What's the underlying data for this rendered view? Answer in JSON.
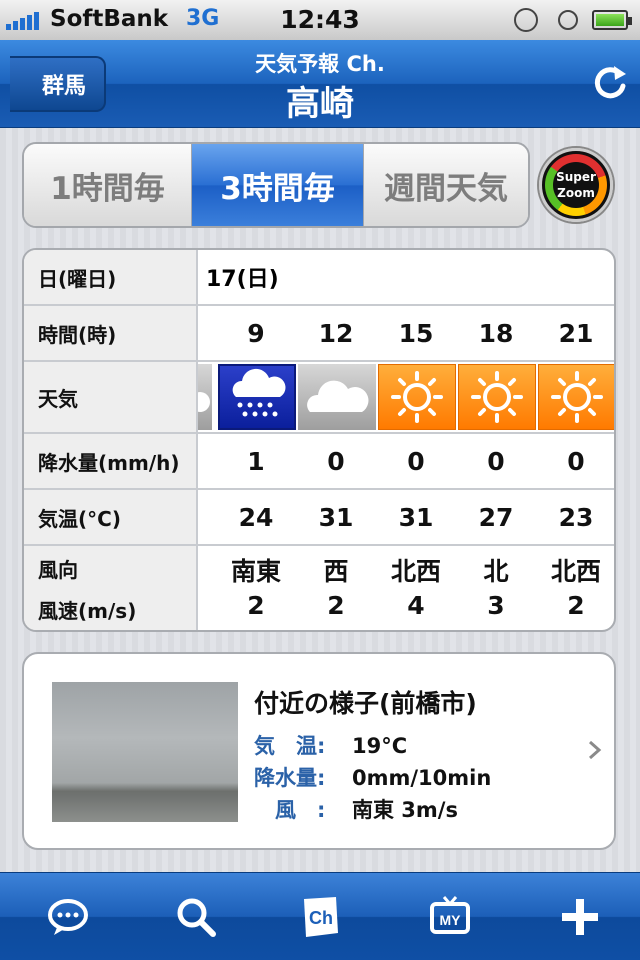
{
  "status_bar": {
    "carrier": "SoftBank",
    "network": "3G",
    "time": "12:43"
  },
  "nav": {
    "back_label": "群馬",
    "subtitle": "天気予報 Ch.",
    "title": "高崎",
    "refresh_icon": "refresh-icon"
  },
  "segments": {
    "items": [
      "1時間毎",
      "3時間毎",
      "週間天気"
    ],
    "selected": "3時間毎"
  },
  "super_zoom": {
    "line1": "Super",
    "line2": "Zoom"
  },
  "forecast": {
    "headers": {
      "date": "日(曜日)",
      "time": "時間(時)",
      "weather": "天気",
      "rain": "降水量(mm/h)",
      "temp": "気温(°C)",
      "wind_dir": "風向",
      "wind_speed": "風速(m/s)"
    },
    "date": "17(日)",
    "columns": [
      {
        "time": "9",
        "weather": "rain",
        "rain": "1",
        "temp": "24",
        "wind_dir": "南東",
        "wind_speed": "2"
      },
      {
        "time": "12",
        "weather": "cloud",
        "rain": "0",
        "temp": "31",
        "wind_dir": "西",
        "wind_speed": "2"
      },
      {
        "time": "15",
        "weather": "sun",
        "rain": "0",
        "temp": "31",
        "wind_dir": "北西",
        "wind_speed": "4"
      },
      {
        "time": "18",
        "weather": "sun",
        "rain": "0",
        "temp": "27",
        "wind_dir": "北",
        "wind_speed": "3"
      },
      {
        "time": "21",
        "weather": "sun",
        "rain": "0",
        "temp": "23",
        "wind_dir": "北西",
        "wind_speed": "2"
      }
    ]
  },
  "live": {
    "title": "付近の様子(前橋市)",
    "rows": [
      {
        "key": "気　温:",
        "value": "19°C"
      },
      {
        "key": "降水量:",
        "value": "0mm/10min"
      },
      {
        "key": "　風　:",
        "value": "南東 3m/s"
      }
    ]
  },
  "tabbar": {
    "items": [
      "comment-icon",
      "search-icon",
      "channel-icon",
      "my-tv-icon",
      "add-icon"
    ],
    "ch_label": "Ch",
    "my_label": "MY"
  },
  "colors": {
    "accent_blue": "#1c5fc6",
    "sun_orange": "#ff8a00",
    "rain_blue": "#0b1f9c"
  }
}
